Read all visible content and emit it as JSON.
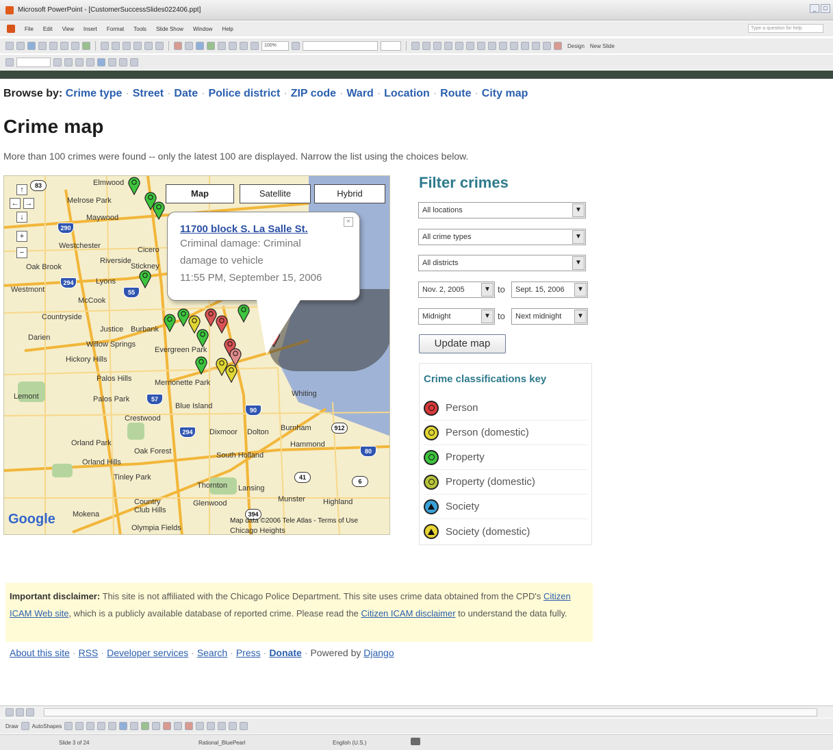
{
  "window": {
    "title": "Microsoft PowerPoint - [CustomerSuccessSlides022406.ppt]",
    "controls": [
      "_",
      "□"
    ]
  },
  "menubar": {
    "items": [
      "File",
      "Edit",
      "View",
      "Insert",
      "Format",
      "Tools",
      "Slide Show",
      "Window",
      "Help"
    ],
    "help_placeholder": "Type a question for help"
  },
  "toolbar": {
    "zoom": "100%",
    "design_label": "Design",
    "new_slide_label": "New Slide"
  },
  "browse": {
    "prefix": "Browse by:",
    "links": [
      "Crime type",
      "Street",
      "Date",
      "Police district",
      "ZIP code",
      "Ward",
      "Location",
      "Route",
      "City map"
    ]
  },
  "page": {
    "title": "Crime map",
    "notice": "More than 100 crimes were found -- only the latest 100 are displayed. Narrow the list using the choices below."
  },
  "map": {
    "types": [
      "Map",
      "Satellite",
      "Hybrid"
    ],
    "active_type": "Map",
    "info_window": {
      "address": "11700 block S. La Salle St.",
      "description_line1": "Criminal damage: Criminal",
      "description_line2": "damage to vehicle",
      "time": "11:55 PM, September 15, 2006"
    },
    "places": [
      "Elmwood",
      "Melrose Park",
      "Maywood",
      "Westchester",
      "Cicero",
      "Riverside",
      "Stickney",
      "Oak Brook",
      "Lyons",
      "Westmont",
      "McCook",
      "Countryside",
      "Justice",
      "Burbank",
      "Darien",
      "Willow Springs",
      "Evergreen Park",
      "Hickory Hills",
      "Palos Hills",
      "Merrionette Park",
      "Lemont",
      "Palos Park",
      "Blue Island",
      "Whiting",
      "Crestwood",
      "Dixmoor",
      "Dolton",
      "Burnham",
      "Orland Park",
      "Oak Forest",
      "Hammond",
      "Orland Hills",
      "South Holland",
      "Tinley Park",
      "Thornton",
      "Lansing",
      "Munster",
      "Highland",
      "Country Club Hills",
      "Glenwood",
      "Mokena",
      "Olympia Fields",
      "Chicago Heights"
    ],
    "highways": [
      "83",
      "290",
      "294",
      "55",
      "57",
      "90",
      "294",
      "912",
      "80",
      "41",
      "6",
      "394"
    ],
    "copyright": "Map data ©2006 Tele Atlas - Terms of Use",
    "logo": "Google"
  },
  "filter": {
    "heading": "Filter crimes",
    "location": "All locations",
    "crime_type": "All crime types",
    "district": "All districts",
    "date_from": "Nov. 2, 2005",
    "date_to": "Sept. 15, 2006",
    "time_from": "Midnight",
    "time_to": "Next midnight",
    "to_label": "to",
    "update_button": "Update map"
  },
  "key": {
    "title": "Crime classifications key",
    "items": [
      {
        "label": "Person",
        "color": "#d93a3a",
        "mark": "circle"
      },
      {
        "label": "Person (domestic)",
        "color": "#e0d633",
        "mark": "circle"
      },
      {
        "label": "Property",
        "color": "#3ec43e",
        "mark": "circle"
      },
      {
        "label": "Property (domestic)",
        "color": "#b8c43a",
        "mark": "circle"
      },
      {
        "label": "Society",
        "color": "#3aa0d9",
        "mark": "triangle"
      },
      {
        "label": "Society (domestic)",
        "color": "#e8d533",
        "mark": "triangle"
      }
    ]
  },
  "disclaimer": {
    "lead": "Important disclaimer:",
    "text1": "This site is not affiliated with the Chicago Police Department. This site uses crime data obtained from the CPD's",
    "link1": "Citizen ICAM Web site",
    "text2": ", which is a publicly available database of reported crime. Please read the",
    "link2": "Citizen ICAM disclaimer",
    "text3": "to understand the data fully."
  },
  "footer": {
    "links": [
      "About this site",
      "RSS",
      "Developer services",
      "Search",
      "Press",
      "Donate"
    ],
    "powered_prefix": "Powered by",
    "powered_link": "Django"
  },
  "status": {
    "slide": "Slide 3 of 24",
    "theme": "Rational_BluePearl",
    "language": "English (U.S.)"
  },
  "drawbar": {
    "draw_label": "Draw",
    "autoshapes_label": "AutoShapes"
  }
}
